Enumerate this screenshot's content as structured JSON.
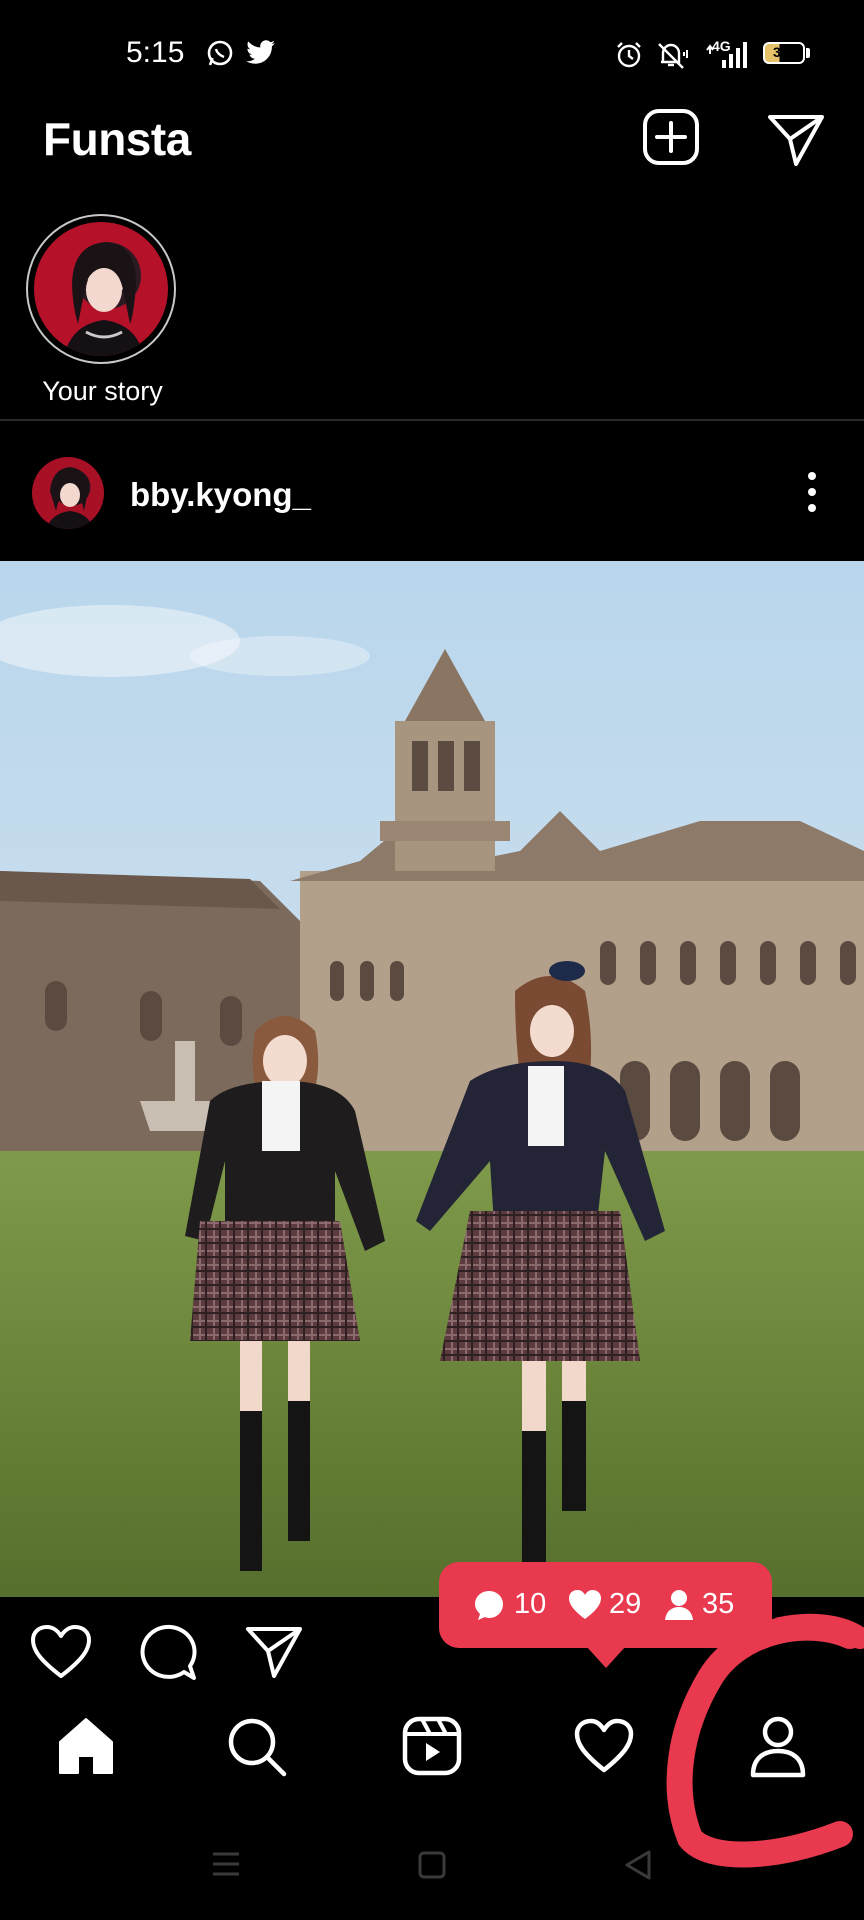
{
  "status_bar": {
    "time": "5:15",
    "network": "4G",
    "battery": "36",
    "icons": [
      "whatsapp-icon",
      "twitter-icon",
      "alarm-icon",
      "mute-icon",
      "signal-icon",
      "battery-icon"
    ]
  },
  "header": {
    "title": "Funsta",
    "icons": [
      "add-post-icon",
      "send-icon"
    ]
  },
  "stories": [
    {
      "label": "Your story"
    }
  ],
  "post": {
    "username": "bby.kyong_",
    "actions": [
      "like-icon",
      "comment-icon",
      "share-icon"
    ]
  },
  "activity_tooltip": {
    "comments": "10",
    "likes": "29",
    "followers": "35",
    "color": "#e8394f"
  },
  "bottom_nav": {
    "items": [
      "home-icon",
      "search-icon",
      "reels-icon",
      "activity-icon",
      "profile-icon"
    ]
  },
  "colors": {
    "background": "#000000",
    "accent": "#e8394f"
  }
}
